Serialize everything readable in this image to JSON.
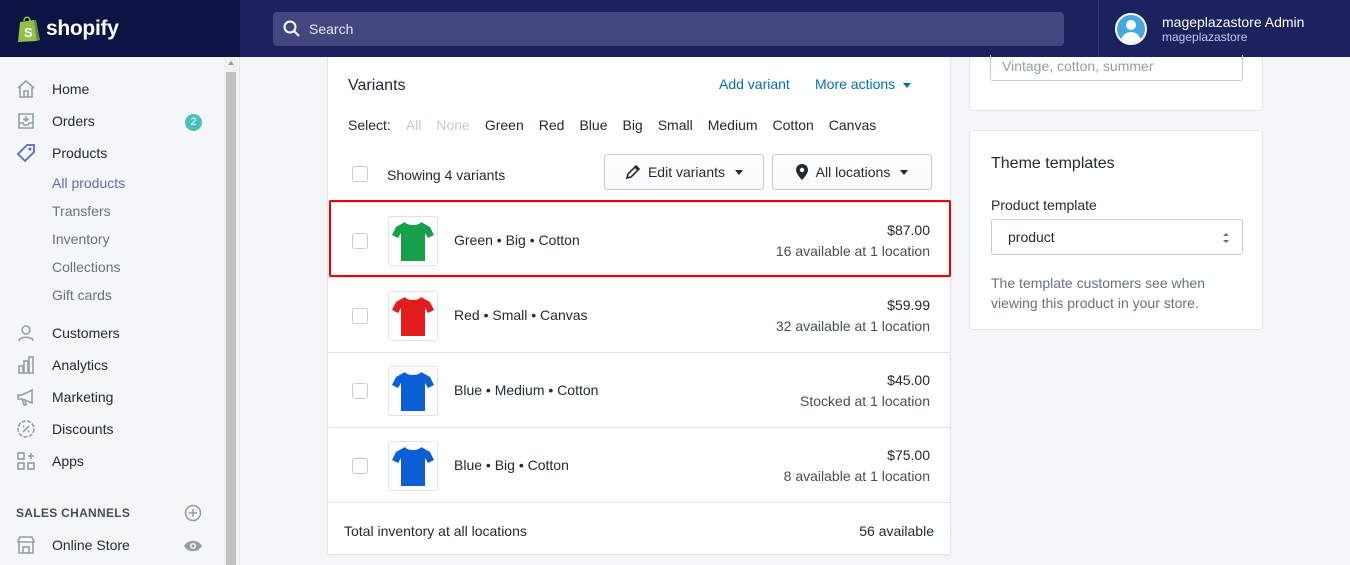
{
  "topbar": {
    "brand": "shopify",
    "search_placeholder": "Search",
    "user_name": "mageplazastore Admin",
    "user_store": "mageplazastore"
  },
  "sidebar": {
    "items": [
      {
        "label": "Home",
        "icon": "home-icon"
      },
      {
        "label": "Orders",
        "icon": "orders-icon",
        "badge": "2"
      },
      {
        "label": "Products",
        "icon": "tag-icon"
      },
      {
        "label": "Customers",
        "icon": "person-icon"
      },
      {
        "label": "Analytics",
        "icon": "bar-chart-icon"
      },
      {
        "label": "Marketing",
        "icon": "megaphone-icon"
      },
      {
        "label": "Discounts",
        "icon": "discount-icon"
      },
      {
        "label": "Apps",
        "icon": "apps-icon"
      }
    ],
    "product_subitems": [
      "All products",
      "Transfers",
      "Inventory",
      "Collections",
      "Gift cards"
    ],
    "sales_channels_heading": "SALES CHANNELS",
    "online_store": "Online Store"
  },
  "variants": {
    "title": "Variants",
    "add_variant": "Add variant",
    "more_actions": "More actions",
    "select_label": "Select:",
    "select_options": [
      "All",
      "None",
      "Green",
      "Red",
      "Blue",
      "Big",
      "Small",
      "Medium",
      "Cotton",
      "Canvas"
    ],
    "showing": "Showing 4 variants",
    "edit_variants": "Edit variants",
    "all_locations": "All locations",
    "rows": [
      {
        "name": "Green • Big • Cotton",
        "price": "$87.00",
        "stock": "16 available at 1 location",
        "color": "#16a04a"
      },
      {
        "name": "Red • Small • Canvas",
        "price": "$59.99",
        "stock": "32 available at 1 location",
        "color": "#e31d1d"
      },
      {
        "name": "Blue • Medium • Cotton",
        "price": "$45.00",
        "stock": "Stocked at 1 location",
        "color": "#0a5fd6"
      },
      {
        "name": "Blue • Big • Cotton",
        "price": "$75.00",
        "stock": "8 available at 1 location",
        "color": "#0a5fd6"
      }
    ],
    "total_label": "Total inventory at all locations",
    "total_value": "56 available"
  },
  "tags": {
    "placeholder": "Vintage, cotton, summer"
  },
  "theme_templates": {
    "title": "Theme templates",
    "label": "Product template",
    "value": "product",
    "help": "The template customers see when viewing this product in your store."
  }
}
